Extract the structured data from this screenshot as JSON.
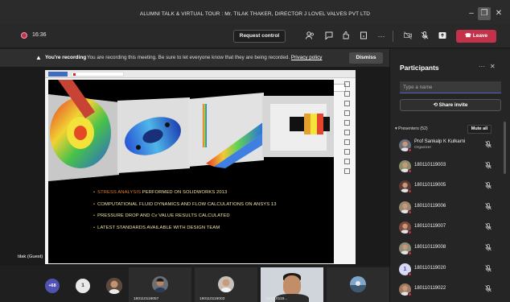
{
  "window": {
    "title": "ALUMNI TALK & VIRTUAL TOUR : Mr. TILAK THAKER, DIRECTOR J LOVEL VALVES PVT LTD",
    "minimize": "–",
    "maximize": "❐",
    "close": "✕"
  },
  "toolbar": {
    "timer": "16:36",
    "request_control": "Request control",
    "leave": "Leave",
    "leave_icon": "☎"
  },
  "banner": {
    "bold": "You're recording",
    "message": "You are recording this meeting. Be sure to let everyone know that they are being recorded.",
    "link": "Privacy policy",
    "dismiss": "Dismiss"
  },
  "slide": {
    "bullets": [
      {
        "highlight": "STRESS ANALYSIS",
        "rest": " PERFORMED ON SOLIDWORKS 2013"
      },
      {
        "highlight": "",
        "rest": "COMPUTATIONAL FLUID DYNAMICS AND FLOW CALCULATIONS ON ANSYS 13"
      },
      {
        "highlight": "",
        "rest": "PRESSURE DROP AND Cv VALUE RESULTS CALCULATED"
      },
      {
        "highlight": "",
        "rest": "LATEST STANDARDS AVAILABLE WITH DESIGN TEAM"
      }
    ],
    "presenter_label": "tilak (Guest)"
  },
  "strip": {
    "more_count": "+68",
    "one_label": "1",
    "tiles": [
      {
        "name": "180110119057"
      },
      {
        "name": "190110119003"
      },
      {
        "name": "180110119..."
      }
    ]
  },
  "panel": {
    "title": "Participants",
    "more": "···",
    "close": "✕",
    "search_placeholder": "Type a name",
    "share_invite": "Share invite",
    "presenters": "Presenters (52)",
    "mute_all": "Mute all",
    "participants": [
      {
        "name": "Prof Sankalp K Kulkarni",
        "role": "Organizer",
        "avatar_color": "#6b6f7a"
      },
      {
        "name": "180110119003",
        "role": "",
        "avatar_color": "#8a8f6a"
      },
      {
        "name": "180110119005",
        "role": "",
        "avatar_color": "#5a3b33"
      },
      {
        "name": "180110119006",
        "role": "",
        "avatar_color": "#9a8770"
      },
      {
        "name": "180110119007",
        "role": "",
        "avatar_color": "#7d4a3d"
      },
      {
        "name": "180110119008",
        "role": "",
        "avatar_color": "#8d8d7a"
      },
      {
        "name": "180110119020",
        "role": "",
        "avatar_color": "#d7d9f5",
        "initial": "1"
      },
      {
        "name": "180110119022",
        "role": "",
        "avatar_color": "#a07a62"
      }
    ]
  }
}
